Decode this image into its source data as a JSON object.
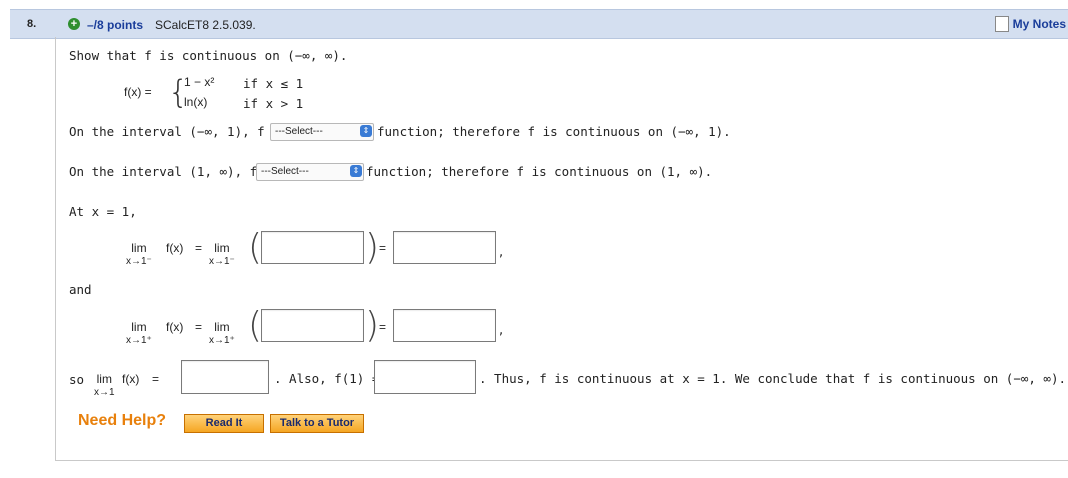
{
  "header": {
    "question_number": "8.",
    "points": "–/8 points",
    "source": "SCalcET8 2.5.039.",
    "notes": "My Notes"
  },
  "problem": {
    "prompt": "Show that f is continuous on (−∞, ∞).",
    "fx": "f(x) =",
    "piece1": "1 − x²",
    "cond1": "if x ≤ 1",
    "piece2": "ln(x)",
    "cond2": "if x > 1",
    "line1_pre": "On the interval  (−∞, 1),  f is",
    "line1_post": "function; therefore f is continuous on  (−∞, 1).",
    "line2_pre": "On the interval  (1, ∞),  f is",
    "line2_post": "function; therefore f is continuous on  (1, ∞).",
    "select_placeholder": "---Select---",
    "at_x": "At  x = 1,",
    "lim_word": "lim",
    "fx_short": "f(x)",
    "eq": "=",
    "sub_left": "x→1⁻",
    "sub_right": "x→1⁺",
    "sub_limit": "x→1",
    "comma": ",",
    "and": "and",
    "so": "so",
    "also": ".  Also,  f(1) =",
    "conclusion": ".  Thus, f is continuous at  x = 1.  We conclude that f is continuous on  (−∞, ∞)."
  },
  "help": {
    "label": "Need Help?",
    "read_it": "Read It",
    "talk_to_tutor": "Talk to a Tutor"
  },
  "colors": {
    "header_bg": "#d4dff0",
    "link_blue": "#1a3d9a",
    "help_orange": "#e8800c"
  }
}
